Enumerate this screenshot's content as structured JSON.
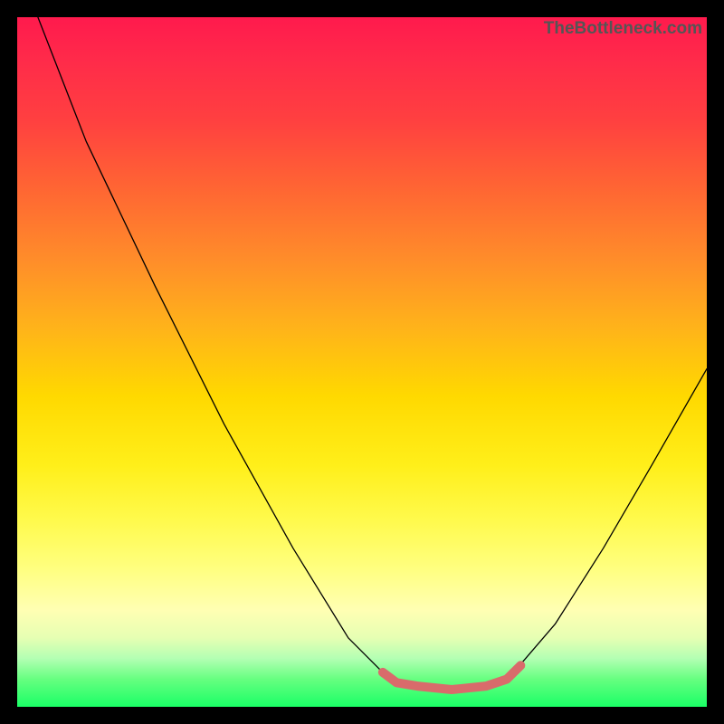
{
  "watermark": "TheBottleneck.com",
  "chart_data": {
    "type": "line",
    "title": "",
    "xlabel": "",
    "ylabel": "",
    "xlim": [
      0,
      100
    ],
    "ylim": [
      0,
      100
    ],
    "grid": false,
    "background_gradient": {
      "direction": "vertical",
      "stops": [
        {
          "pos": 0,
          "color": "#ff1a4d"
        },
        {
          "pos": 50,
          "color": "#ffd900"
        },
        {
          "pos": 90,
          "color": "#ffffb3"
        },
        {
          "pos": 100,
          "color": "#1aff66"
        }
      ]
    },
    "series": [
      {
        "name": "bottleneck-curve",
        "color": "#000000",
        "width": 1.3,
        "points": [
          {
            "x": 3,
            "y": 100
          },
          {
            "x": 10,
            "y": 82
          },
          {
            "x": 20,
            "y": 61
          },
          {
            "x": 30,
            "y": 41
          },
          {
            "x": 40,
            "y": 23
          },
          {
            "x": 48,
            "y": 10
          },
          {
            "x": 53,
            "y": 5
          },
          {
            "x": 57,
            "y": 3
          },
          {
            "x": 63,
            "y": 2.5
          },
          {
            "x": 69,
            "y": 3
          },
          {
            "x": 72,
            "y": 5
          },
          {
            "x": 78,
            "y": 12
          },
          {
            "x": 85,
            "y": 23
          },
          {
            "x": 92,
            "y": 35
          },
          {
            "x": 100,
            "y": 49
          }
        ]
      },
      {
        "name": "optimal-zone-marker",
        "color": "#d96b6b",
        "width": 10,
        "points": [
          {
            "x": 53,
            "y": 5
          },
          {
            "x": 55,
            "y": 3.5
          },
          {
            "x": 58,
            "y": 3
          },
          {
            "x": 63,
            "y": 2.5
          },
          {
            "x": 68,
            "y": 3
          },
          {
            "x": 71,
            "y": 4
          },
          {
            "x": 73,
            "y": 6
          }
        ]
      }
    ]
  }
}
